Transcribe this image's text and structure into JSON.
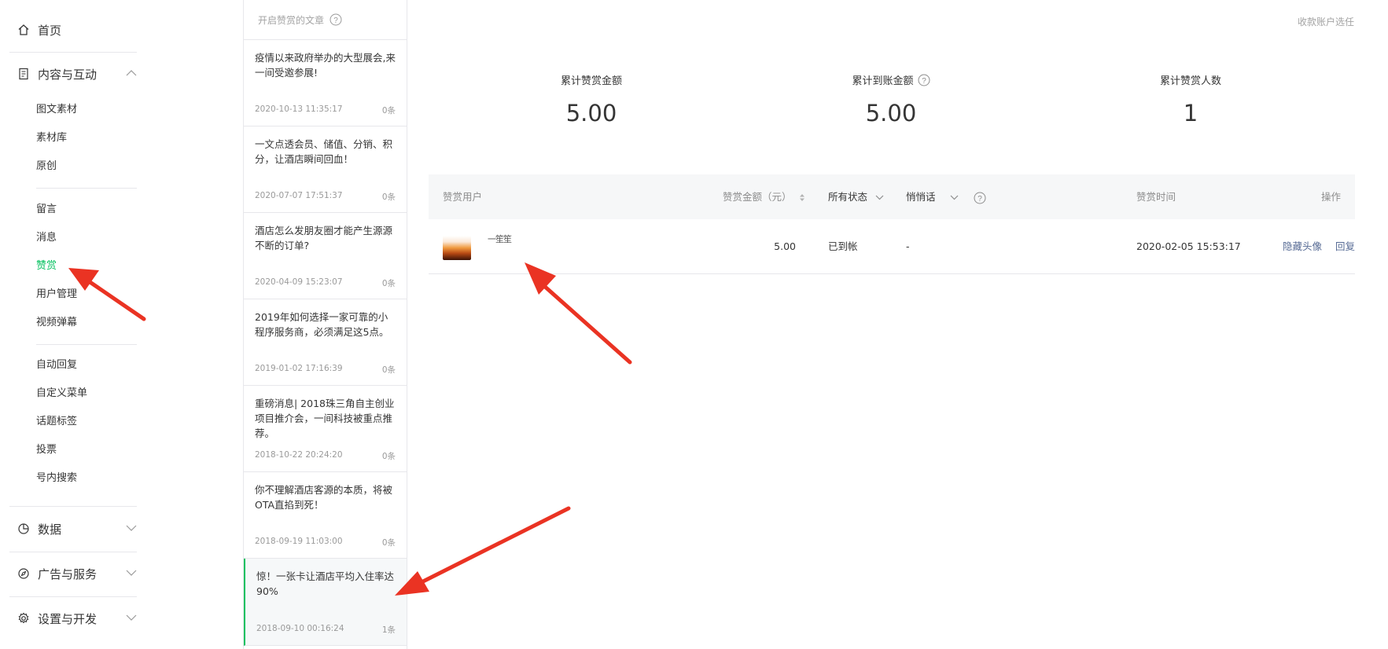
{
  "nav": {
    "home": "首页",
    "groups": {
      "content": "内容与互动",
      "data": "数据",
      "ads": "广告与服务",
      "settings": "设置与开发"
    },
    "content_items": [
      "图文素材",
      "素材库",
      "原创",
      "留言",
      "消息",
      "赞赏",
      "用户管理",
      "视频弹幕",
      "自动回复",
      "自定义菜单",
      "话题标签",
      "投票",
      "号内搜索"
    ],
    "active_item": "赞赏"
  },
  "articles": {
    "header": "开启赞赏的文章",
    "items": [
      {
        "title": "疫情以来政府举办的大型展会,来一间受邀参展!",
        "date": "2020-10-13 11:35:17",
        "count": "0条"
      },
      {
        "title": "一文点透会员、储值、分销、积分，让酒店瞬间回血！",
        "date": "2020-07-07 17:51:37",
        "count": "0条"
      },
      {
        "title": "酒店怎么发朋友圈才能产生源源不断的订单?",
        "date": "2020-04-09 15:23:07",
        "count": "0条"
      },
      {
        "title": "2019年如何选择一家可靠的小程序服务商，必须满足这5点。",
        "date": "2019-01-02 17:16:39",
        "count": "0条"
      },
      {
        "title": "重磅消息| 2018珠三角自主创业项目推介会，一间科技被重点推荐。",
        "date": "2018-10-22 20:24:20",
        "count": "0条"
      },
      {
        "title": "你不理解酒店客源的本质，将被OTA直掐到死！",
        "date": "2018-09-19 11:03:00",
        "count": "0条"
      },
      {
        "title": "惊！一张卡让酒店平均入住率达90%",
        "date": "2018-09-10 00:16:24",
        "count": "1条"
      }
    ]
  },
  "main": {
    "top_link": "收款账户选任",
    "stats": [
      {
        "label": "累计赞赏金额",
        "value": "5.00",
        "help": false
      },
      {
        "label": "累计到账金额",
        "value": "5.00",
        "help": true
      },
      {
        "label": "累计赞赏人数",
        "value": "1",
        "help": false
      }
    ],
    "table": {
      "headers": {
        "user": "赞赏用户",
        "amount": "赞赏金额（元）",
        "status": "所有状态",
        "message": "悄悄话",
        "time": "赞赏时间",
        "action": "操作"
      },
      "rows": [
        {
          "user": "一笙笙",
          "amount": "5.00",
          "status": "已到帐",
          "message": "-",
          "time": "2020-02-05 15:53:17",
          "actions": [
            "隐藏头像",
            "回复"
          ]
        }
      ]
    }
  },
  "colors": {
    "accent": "#07c160",
    "link": "#576b95",
    "annotation": "#ea3323"
  }
}
